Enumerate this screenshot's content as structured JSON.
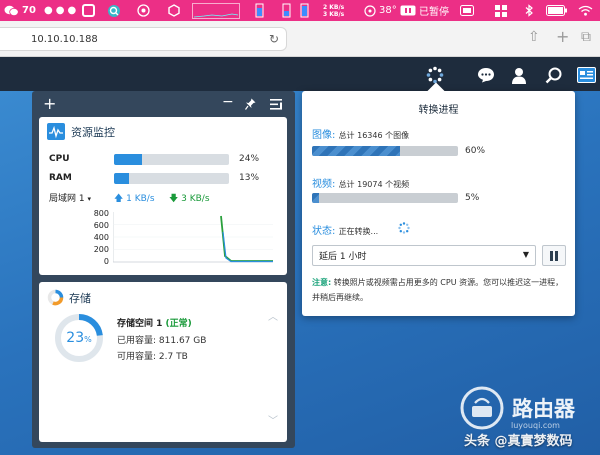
{
  "menubar": {
    "wechat_count": "70",
    "net_up": "2 KB/s",
    "net_down": "3 KB/s",
    "temp": "38°",
    "pause_label": "已暂停"
  },
  "browser": {
    "url": "10.10.10.188"
  },
  "resource_monitor": {
    "title": "资源监控",
    "cpu_label": "CPU",
    "cpu_pct": "24%",
    "cpu_fill": 0.24,
    "ram_label": "RAM",
    "ram_pct": "13%",
    "ram_fill": 0.13,
    "lan_label": "局域网 1",
    "upload": "1 KB/s",
    "download": "3 KB/s",
    "chart_ticks": [
      "800",
      "600",
      "400",
      "200",
      "0"
    ]
  },
  "storage": {
    "title": "存储",
    "donut_pct": "23",
    "donut_unit": "%",
    "donut_fill": 0.23,
    "volume_name": "存储空间 1",
    "volume_status": "(正常)",
    "used_label": "已用容量:",
    "used_value": "811.67 GB",
    "free_label": "可用容量:",
    "free_value": "2.7 TB"
  },
  "conversion": {
    "title": "转换进程",
    "photo_label": "图像:",
    "photo_detail": "总计 16346 个图像",
    "photo_pct": "60%",
    "photo_fill": 0.6,
    "video_label": "视频:",
    "video_detail": "总计 19074 个视频",
    "video_pct": "5%",
    "video_fill": 0.05,
    "status_label": "状态:",
    "status_value": "正在转换...",
    "delay_option": "延后 1 小时",
    "note_label": "注意:",
    "note_text": "转换照片或视频需占用更多的 CPU 资源。您可以推迟这一进程，并稍后再继续。"
  },
  "watermark": {
    "brand": "路由器",
    "site": "luyouqi.com",
    "credit": "头条 @真實梦数码"
  }
}
